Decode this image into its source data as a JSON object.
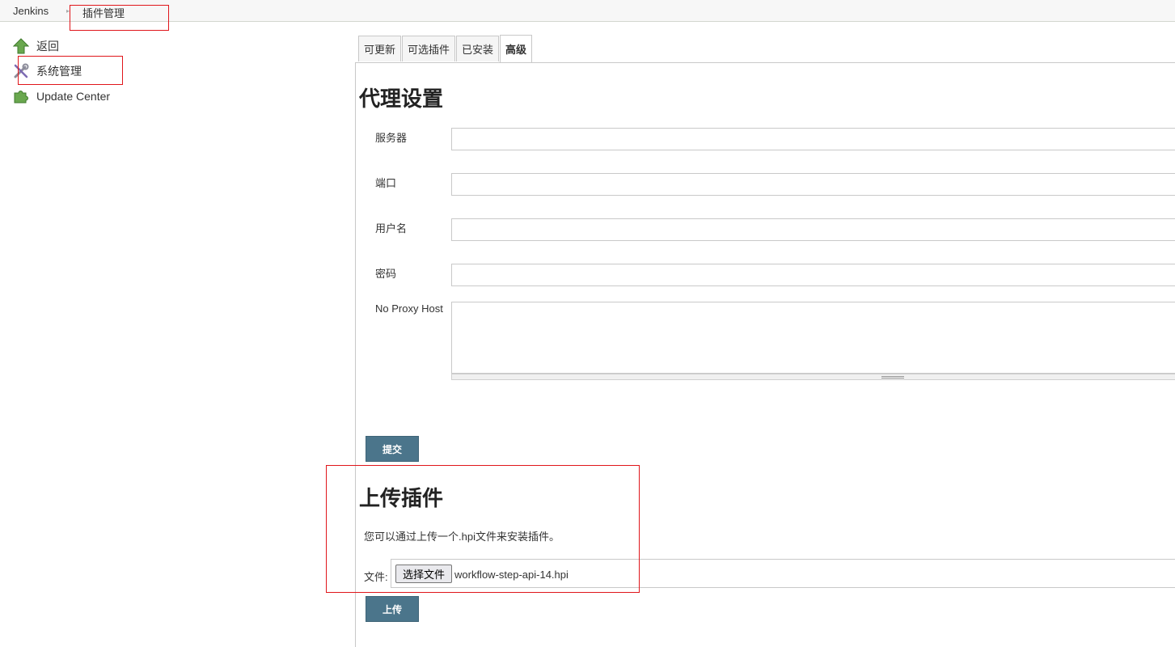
{
  "breadcrumb": {
    "home": "Jenkins",
    "current": "插件管理"
  },
  "sidebar": {
    "items": [
      {
        "label": "返回",
        "icon": "up-arrow-icon"
      },
      {
        "label": "系统管理",
        "icon": "wrench-screwdriver-icon"
      },
      {
        "label": "Update Center",
        "icon": "puzzle-icon"
      }
    ]
  },
  "tabs": [
    {
      "label": "可更新",
      "active": false
    },
    {
      "label": "可选插件",
      "active": false
    },
    {
      "label": "已安装",
      "active": false
    },
    {
      "label": "高级",
      "active": true
    }
  ],
  "proxy": {
    "title": "代理设置",
    "fields": {
      "server": {
        "label": "服务器",
        "value": ""
      },
      "port": {
        "label": "端口",
        "value": ""
      },
      "username": {
        "label": "用户名",
        "value": ""
      },
      "password": {
        "label": "密码",
        "value": ""
      },
      "no_proxy": {
        "label": "No Proxy Host",
        "value": ""
      }
    },
    "submit_label": "提交"
  },
  "upload": {
    "title": "上传插件",
    "description": "您可以通过上传一个.hpi文件来安装插件。",
    "file_label": "文件:",
    "choose_button": "选择文件",
    "file_name": "workflow-step-api-14.hpi",
    "upload_button": "上传"
  },
  "colors": {
    "button_bg": "#4b758b",
    "annotation_red": "#e0161b",
    "icon_green": "#6aa84f"
  }
}
